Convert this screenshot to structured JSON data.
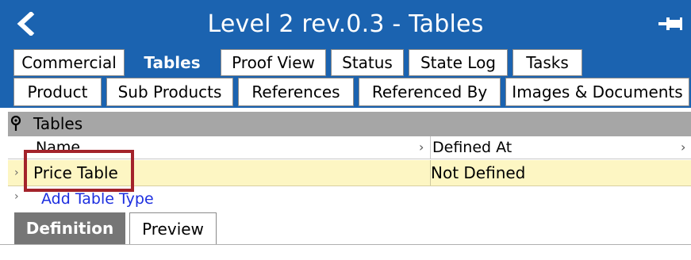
{
  "window": {
    "title": "Level 2 rev.0.3 - Tables",
    "back_icon": "chevron-left-icon",
    "pin_icon": "pin-icon"
  },
  "tabs_row1": [
    "Commercial",
    "Tables",
    "Proof View",
    "Status",
    "State Log",
    "Tasks"
  ],
  "tabs_row2": [
    "Product",
    "Sub Products",
    "References",
    "Referenced By",
    "Images & Documents"
  ],
  "active_tab": "Tables",
  "section": {
    "title": "Tables",
    "icon": "pin-icon"
  },
  "grid": {
    "columns": [
      "Name",
      "Defined At"
    ],
    "rows": [
      {
        "name": "Price Table",
        "defined_at": "Not Defined"
      }
    ],
    "add_link": "Add Table Type"
  },
  "bottom_tabs": [
    "Definition",
    "Preview"
  ],
  "bottom_active": "Definition",
  "colors": {
    "title_bar": "#1b63b0",
    "selected_row": "#fdf6c3",
    "highlight_box": "#a3232b",
    "link": "#1d2fe0"
  }
}
